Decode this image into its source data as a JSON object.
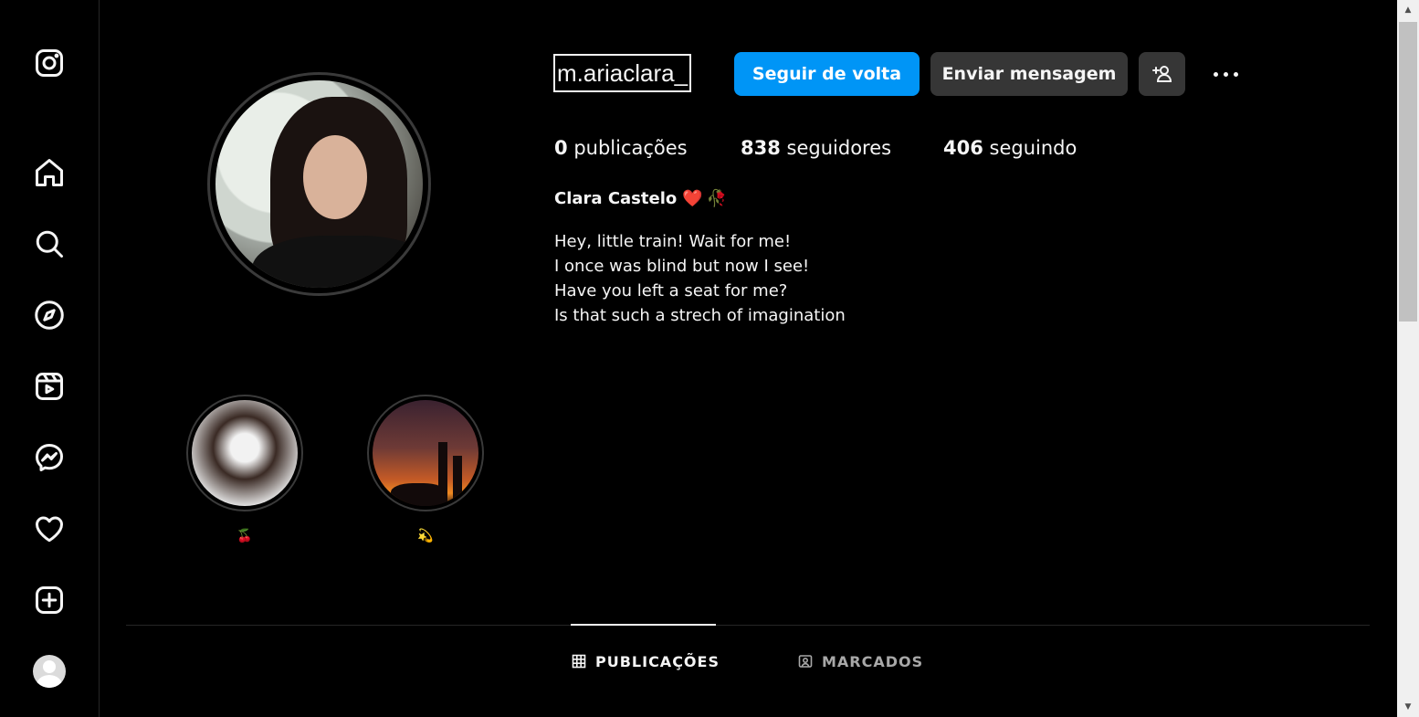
{
  "sidebar": {
    "icons": [
      "instagram-logo-icon",
      "home-icon",
      "search-icon",
      "explore-compass-icon",
      "reels-icon",
      "messenger-icon",
      "heart-icon",
      "create-plus-icon",
      "profile-avatar-icon"
    ]
  },
  "profile": {
    "username": "m.ariaclara_",
    "follow_back_label": "Seguir de volta",
    "send_message_label": "Enviar mensagem",
    "stats": {
      "posts_count": "0",
      "posts_label": "publicações",
      "followers_count": "838",
      "followers_label": "seguidores",
      "following_count": "406",
      "following_label": "seguindo"
    },
    "full_name": "Clara Castelo",
    "full_name_emoji_1": "❤️",
    "full_name_emoji_2": "🥀",
    "bio_lines": [
      "Hey, little train! Wait for me!",
      "I once was blind but now I see!",
      "Have you left a seat for me?",
      "Is that such a strech of imagination"
    ]
  },
  "highlights": [
    {
      "label": "🍒"
    },
    {
      "label": "💫"
    }
  ],
  "tabs": {
    "posts_label": "PUBLICAÇÕES",
    "tagged_label": "MARCADOS"
  },
  "colors": {
    "background": "#000000",
    "accent_blue": "#0095f6",
    "button_gray": "#363636",
    "text_primary": "#f5f5f5",
    "text_secondary": "#a8a8a8"
  }
}
